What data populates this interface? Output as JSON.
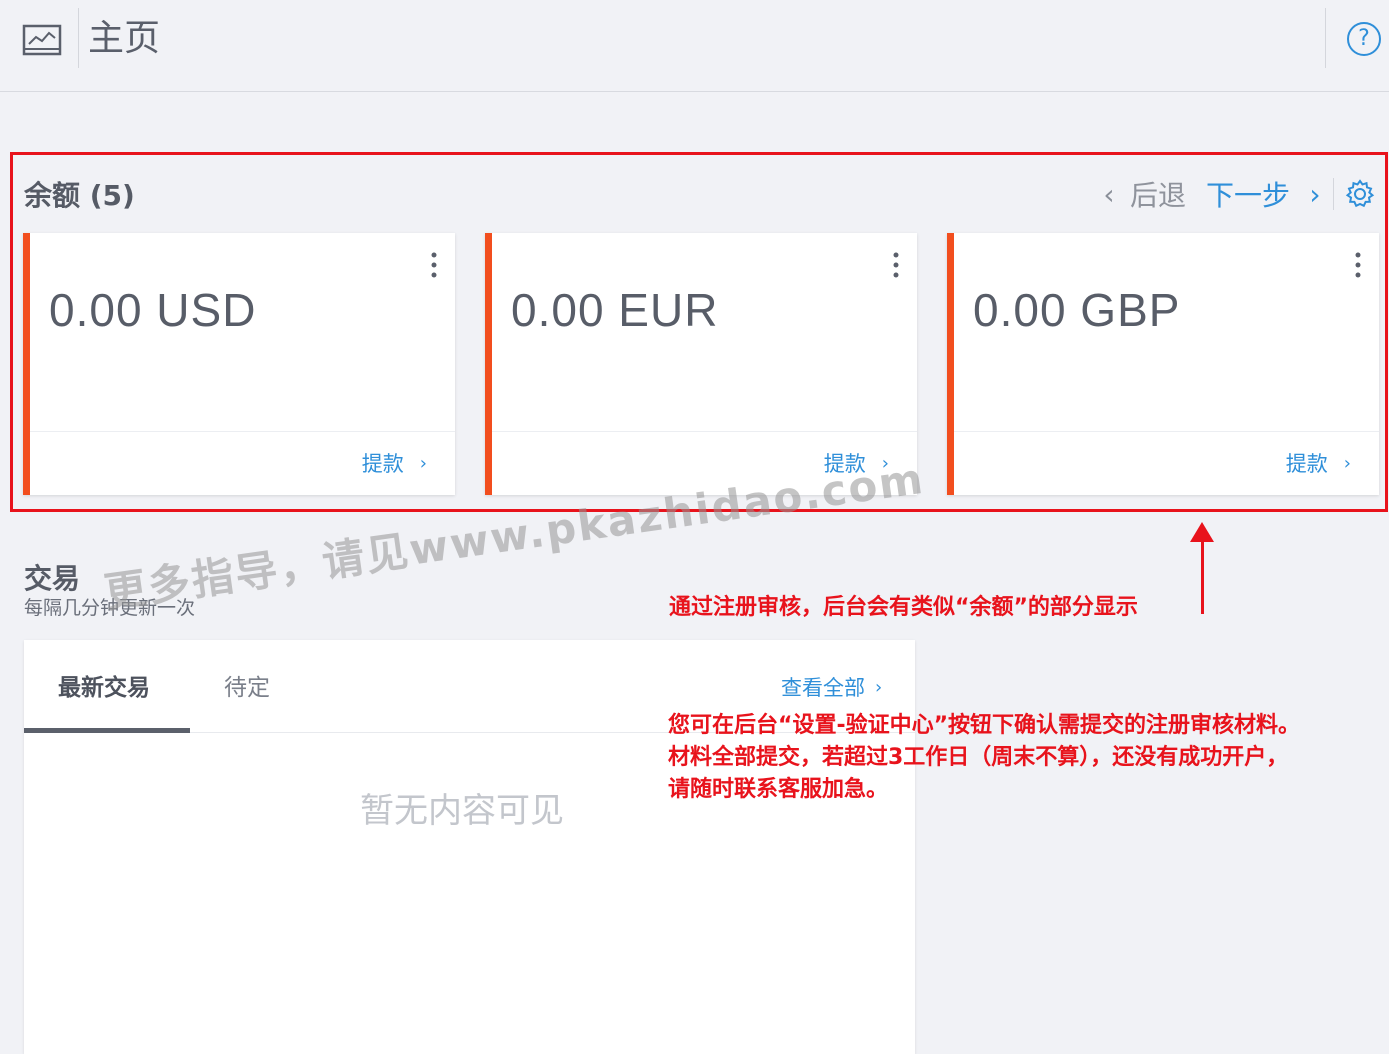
{
  "header": {
    "title": "主页",
    "chart_icon": "chart-icon",
    "help_icon": "help-icon",
    "help_glyph": "?"
  },
  "balance": {
    "title": "余额 (5)",
    "prev_glyph": "‹",
    "back_label": "后退",
    "next_label": "下一步",
    "next_glyph": "›",
    "settings_icon": "gear-icon",
    "accent_color": "#f24e1e",
    "cards": [
      {
        "amount": "0.00 USD",
        "withdraw_label": "提款",
        "chevron": "›"
      },
      {
        "amount": "0.00 EUR",
        "withdraw_label": "提款",
        "chevron": "›"
      },
      {
        "amount": "0.00 GBP",
        "withdraw_label": "提款",
        "chevron": "›"
      }
    ]
  },
  "transactions": {
    "title": "交易",
    "subtitle": "每隔几分钟更新一次",
    "tabs": [
      {
        "label": "最新交易",
        "active": true
      },
      {
        "label": "待定",
        "active": false
      }
    ],
    "view_all_label": "查看全部",
    "view_all_chevron": "›",
    "empty_text": "暂无内容可见"
  },
  "annotations": {
    "note1": "通过注册审核，后台会有类似“余额”的部分显示",
    "note2_lines": [
      "您可在后台“设置-验证中心”按钮下确认需提交的注册审核材料。",
      "材料全部提交，若超过3工作日（周末不算），还没有成功开户，",
      "请随时联系客服加急。"
    ],
    "highlight_color": "#e8131c"
  },
  "watermark": "更多指导，请见www.pkazhidao.com",
  "colors": {
    "link": "#2f8fd9",
    "background": "#f1f2f6"
  }
}
